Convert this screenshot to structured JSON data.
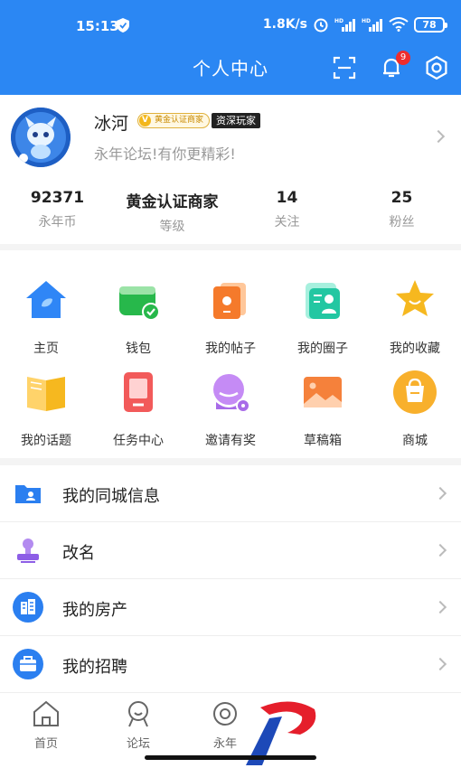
{
  "status_bar": {
    "time": "15:13",
    "net_speed": "1.8K/s",
    "battery": "78"
  },
  "header": {
    "title": "个人中心",
    "notification_count": "9"
  },
  "profile": {
    "name": "冰河",
    "verified_tag": "黄金认证商家",
    "verified_v": "V",
    "level_tag": "资深玩家",
    "motto": "永年论坛!有你更精彩!"
  },
  "stats": [
    {
      "value": "92371",
      "label": "永年币"
    },
    {
      "value": "黄金认证商家",
      "label": "等级"
    },
    {
      "value": "14",
      "label": "关注"
    },
    {
      "value": "25",
      "label": "粉丝"
    }
  ],
  "grid": [
    {
      "label": "主页",
      "icon": "home-icon"
    },
    {
      "label": "钱包",
      "icon": "wallet-icon"
    },
    {
      "label": "我的帖子",
      "icon": "posts-icon"
    },
    {
      "label": "我的圈子",
      "icon": "circle-icon"
    },
    {
      "label": "我的收藏",
      "icon": "star-icon"
    },
    {
      "label": "我的话题",
      "icon": "book-icon"
    },
    {
      "label": "任务中心",
      "icon": "task-icon"
    },
    {
      "label": "邀请有奖",
      "icon": "invite-icon"
    },
    {
      "label": "草稿箱",
      "icon": "draft-icon"
    },
    {
      "label": "商城",
      "icon": "mall-icon"
    }
  ],
  "list": [
    {
      "label": "我的同城信息",
      "icon": "folder-user-icon"
    },
    {
      "label": "改名",
      "icon": "stamp-icon"
    },
    {
      "label": "我的房产",
      "icon": "building-icon"
    },
    {
      "label": "我的招聘",
      "icon": "briefcase-icon"
    }
  ],
  "tabs": [
    {
      "label": "首页",
      "icon": "home-tab-icon"
    },
    {
      "label": "论坛",
      "icon": "forum-tab-icon"
    },
    {
      "label": "永年",
      "icon": "yongnian-tab-icon"
    }
  ],
  "colors": {
    "brand_blue": "#2b87f3",
    "badge_red": "#ef2d2d",
    "gold": "#f3b71c"
  }
}
